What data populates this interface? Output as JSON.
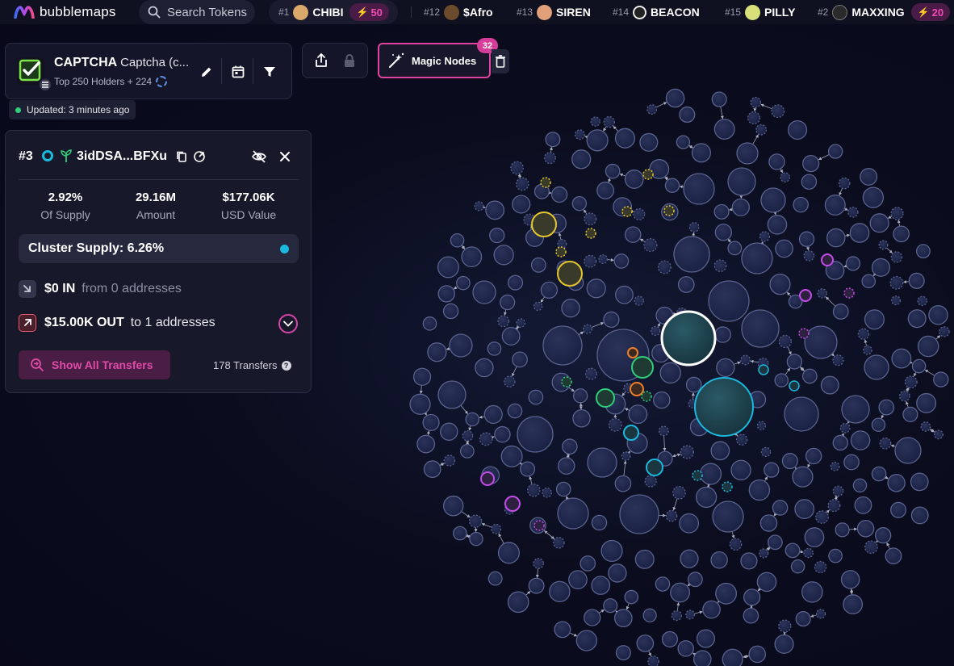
{
  "brand": {
    "name": "bubblemaps"
  },
  "search": {
    "placeholder": "Search Tokens"
  },
  "tickers": [
    {
      "rank": "#1",
      "name": "CHIBI",
      "badge": "50",
      "avatar_color": "#d9a86a"
    },
    {
      "rank": "#12",
      "name": "$Afro",
      "avatar_color": "#6b4b2c"
    },
    {
      "rank": "#13",
      "name": "SIREN",
      "avatar_color": "#e0a07a"
    },
    {
      "rank": "#14",
      "name": "BEACON",
      "avatar_color": "#e8e8e8"
    },
    {
      "rank": "#15",
      "name": "PILLY",
      "avatar_color": "#d8e07a"
    },
    {
      "rank": "#2",
      "name": "MAXXING",
      "badge": "20",
      "avatar_color": "#2a2a2a"
    }
  ],
  "token": {
    "symbol": "CAPTCHA",
    "name": "Captcha (c...",
    "subtitle": "Top 250 Holders + 224"
  },
  "updated": "Updated: 3 minutes ago",
  "magic_nodes": {
    "label": "Magic Nodes",
    "count": "32"
  },
  "detail": {
    "rank": "#3",
    "address": "3idDSA...BFXu",
    "stats": [
      {
        "value": "2.92%",
        "label": "Of Supply"
      },
      {
        "value": "29.16M",
        "label": "Amount"
      },
      {
        "value": "$177.06K",
        "label": "USD Value"
      }
    ],
    "cluster_supply": "Cluster Supply: 6.26%",
    "in": {
      "amount": "$0 IN",
      "text": "from 0 addresses"
    },
    "out": {
      "amount": "$15.00K OUT",
      "text": "to 1 addresses"
    },
    "show_transfers": "Show All Transfers",
    "transfers_count": "178 Transfers",
    "help": "?"
  },
  "colors": {
    "accent_pink": "#e0449f",
    "cyan": "#1ab8dd",
    "yellow": "#e3c62f",
    "green": "#2fcf7c",
    "orange": "#f07f2a",
    "purple": "#c34be8",
    "bubble": "#3a4170"
  }
}
